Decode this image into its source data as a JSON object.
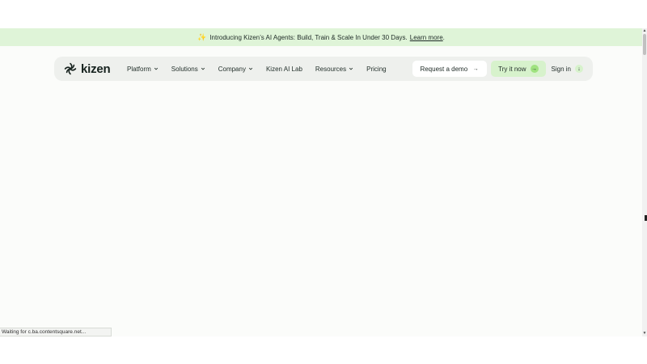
{
  "announcement": {
    "text": "Introducing Kizen’s AI Agents: Build, Train & Scale In Under 30 Days.",
    "link_label": "Learn more",
    "trailing": "."
  },
  "brand": {
    "name": "kizen"
  },
  "nav": {
    "items": [
      {
        "label": "Platform",
        "dropdown": true
      },
      {
        "label": "Solutions",
        "dropdown": true
      },
      {
        "label": "Company",
        "dropdown": true
      },
      {
        "label": "Kizen AI Lab",
        "dropdown": false
      },
      {
        "label": "Resources",
        "dropdown": true
      },
      {
        "label": "Pricing",
        "dropdown": false
      }
    ],
    "request_demo_label": "Request a demo",
    "try_label": "Try it now",
    "signin_label": "Sign in"
  },
  "status": {
    "text": "Waiting for c.ba.contentsquare.net..."
  },
  "colors": {
    "announcement_bg": "#dff4d8",
    "accent_green": "#9fe27f",
    "try_button_bg": "#d7f2cc",
    "navbar_bg": "#eef0ed"
  }
}
